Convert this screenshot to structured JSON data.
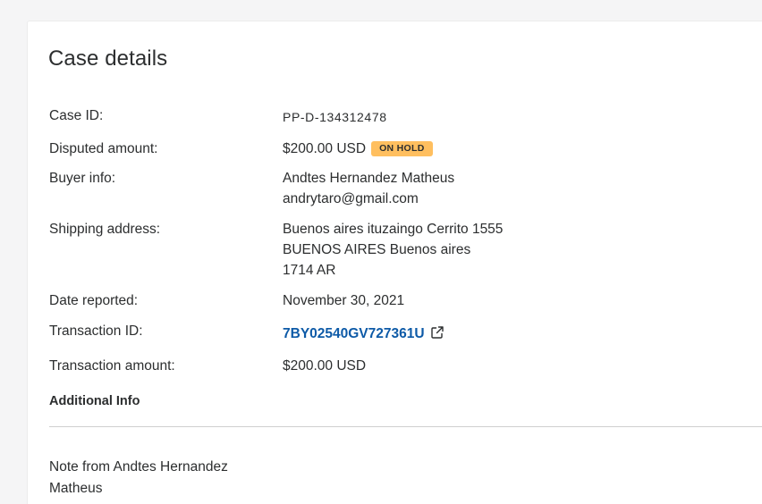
{
  "case": {
    "title": "Case details",
    "labels": {
      "case_id": "Case ID:",
      "disputed_amount": "Disputed amount:",
      "buyer_info": "Buyer info:",
      "shipping_address": "Shipping address:",
      "date_reported": "Date reported:",
      "transaction_id": "Transaction ID:",
      "transaction_amount": "Transaction amount:"
    },
    "values": {
      "case_id": "PP-D-134312478",
      "disputed_amount": "$200.00 USD",
      "status_badge": "ON HOLD",
      "buyer_name": "Andtes Hernandez Matheus",
      "buyer_email": "andrytaro@gmail.com",
      "shipping_line1": "Buenos aires ituzaingo Cerrito 1555",
      "shipping_line2": "BUENOS AIRES Buenos aires",
      "shipping_line3": "1714 AR",
      "date_reported": "November 30, 2021",
      "transaction_id": "7BY02540GV727361U",
      "transaction_amount": "$200.00 USD"
    },
    "additional_info_heading": "Additional Info",
    "note_text": "Note from Andtes Hernandez Matheus"
  },
  "icons": {
    "external_link": "external-link-icon"
  },
  "colors": {
    "link": "#0d5aa7",
    "badge_bg": "#ffbf5f",
    "text": "#2c2e2f"
  }
}
